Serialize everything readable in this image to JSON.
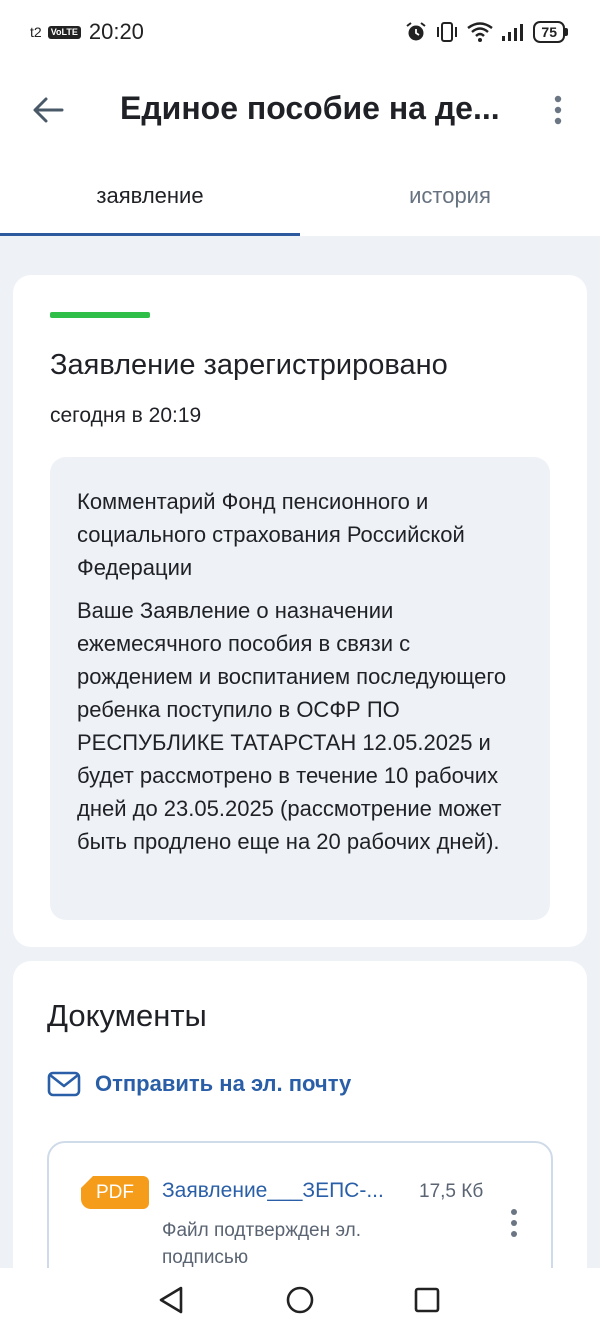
{
  "status_bar": {
    "carrier": "t2",
    "volte": "VoLTE",
    "time": "20:20",
    "battery": "75"
  },
  "app_bar": {
    "title": "Единое пособие на де..."
  },
  "tabs": [
    {
      "label": "заявление",
      "active": true
    },
    {
      "label": "история",
      "active": false
    }
  ],
  "status_card": {
    "accent_color": "#2fbf48",
    "title": "Заявление зарегистрировано",
    "time": "сегодня в 20:19",
    "comment": {
      "heading": "Комментарий Фонд пенсионного и социального страхования Российской Федерации",
      "body": "Ваше Заявление о назначении ежемесячного пособия в связи с рождением и воспитанием последующего ребенка поступило в ОСФР ПО РЕСПУБЛИКЕ ТАТАРСТАН 12.05.2025 и будет рассмотрено в течение 10 рабочих дней до 23.05.2025 (рассмотрение может быть продлено еще на 20 рабочих дней)."
    }
  },
  "documents": {
    "title": "Документы",
    "email_label": "Отправить на эл. почту",
    "files": [
      {
        "type": "PDF",
        "name": "Заявление___ЗЕПС-...",
        "size": "17,5 Кб",
        "signature": "Файл подтвержден эл. подписью"
      }
    ]
  },
  "colors": {
    "link": "#2a5fa8",
    "tab_indicator": "#2d5a9e",
    "pdf_badge": "#f59c1a"
  }
}
